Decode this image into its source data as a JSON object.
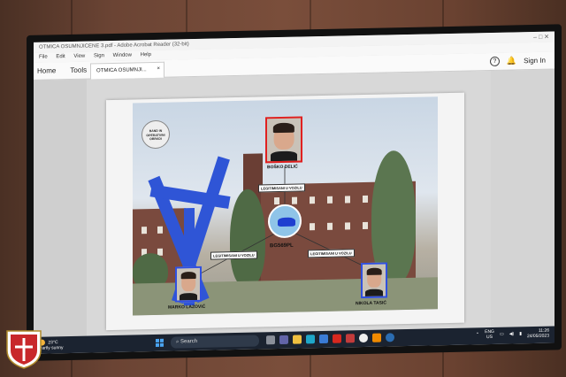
{
  "window": {
    "title": "OTMICA OSUMNJICENE 3.pdf - Adobe Acrobat Reader (32-bit)",
    "controls": "–   □   ✕"
  },
  "menu": [
    "File",
    "Edit",
    "View",
    "Sign",
    "Window",
    "Help"
  ],
  "toolbar": {
    "home": "Home",
    "tools": "Tools",
    "tab": "OTMICA OSUMNJI...",
    "tab_close": "×",
    "help": "?",
    "signin": "Sign In"
  },
  "diagram": {
    "badge": "BAND IN OPERATIVNI OBRADI",
    "top_person": "BOŠKO DELIĆ",
    "left_person": "MARKO LAZOVIĆ",
    "right_person": "NIKOLA TASIĆ",
    "plate": "BG569PL",
    "edge_top": "LEGITIMISANI U VOZILU",
    "edge_left": "LEGITIMISANI U VOZILU",
    "edge_right": "LEGITIMISANI U VOZILU"
  },
  "taskbar": {
    "temp": "23°C",
    "weather": "Partly sunny",
    "search": "Search",
    "lang1": "ENG",
    "lang2": "US",
    "time": "11:26",
    "date": "24/05/2023"
  },
  "colors": {
    "red_frame": "#e02020",
    "blue_frame": "#3050e0",
    "sculpture": "#2f55d6"
  }
}
